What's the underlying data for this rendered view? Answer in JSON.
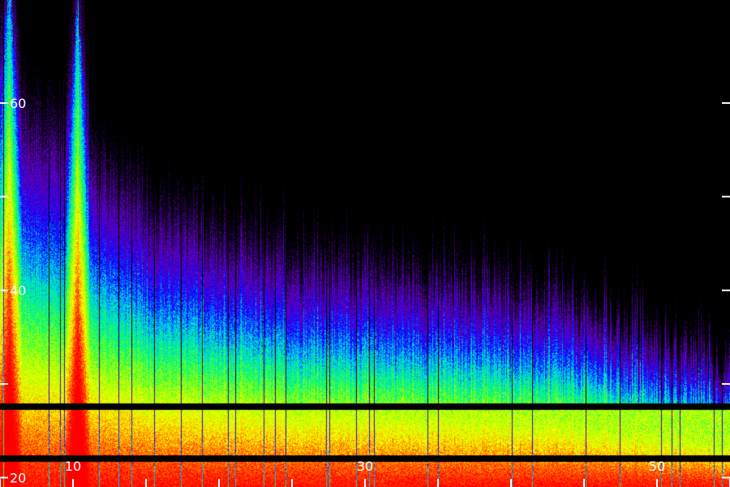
{
  "chart_data": {
    "type": "heatmap",
    "title": "",
    "xlabel": "",
    "ylabel": "",
    "xlim": [
      5,
      55
    ],
    "ylim": [
      19,
      71
    ],
    "x_ticks": [
      10,
      30,
      50
    ],
    "x_minor_ticks": [
      5,
      15,
      20,
      25,
      35,
      40,
      45,
      55
    ],
    "y_ticks": [
      20,
      40,
      60
    ],
    "y_minor_ticks": [
      30,
      50
    ],
    "colormap": [
      "#000000",
      "#330066",
      "#6600cc",
      "#0000ff",
      "#00ccff",
      "#00ff66",
      "#aaff00",
      "#ffff00",
      "#ff6600",
      "#ff0000"
    ],
    "dark_bands_y": [
      27.6,
      22.1
    ],
    "hot_columns_x": [
      5.6,
      10.3
    ],
    "intensity_profile": {
      "x": [
        5,
        10,
        15,
        20,
        25,
        30,
        35,
        40,
        45,
        50,
        55
      ],
      "upper_edge_y": [
        56,
        53,
        46,
        43,
        41,
        40,
        39,
        38,
        36,
        33,
        31
      ]
    }
  }
}
